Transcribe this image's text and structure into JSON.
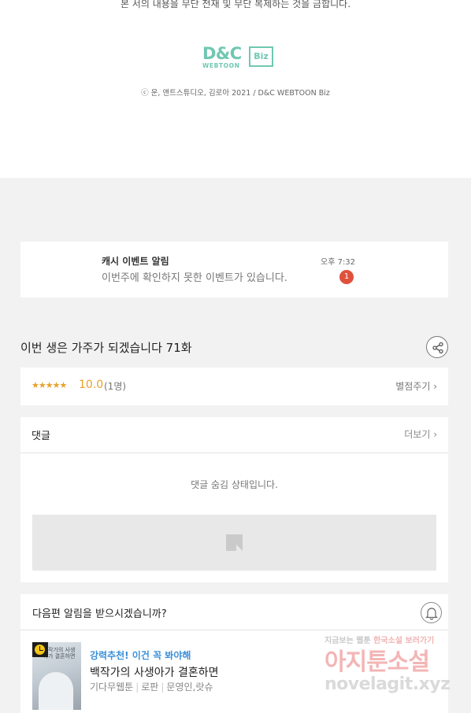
{
  "footer": {
    "notice": "본 서의 내용을 무단 전재 및 무단 복제하는 것을 금합니다.",
    "logo": {
      "main": "D&C",
      "tag": "Biz",
      "sub": "WEBTOON"
    },
    "copyright": "ⓒ 운, 앤트스튜디오, 김로아 2021 / D&C WEBTOON Biz"
  },
  "push_notice": {
    "title": "캐시 이벤트 알림",
    "message": "이번주에 확인하지 못한 이벤트가 있습니다.",
    "time": "오후 7:32",
    "badge": "1"
  },
  "episode": {
    "title": "이번 생은 가주가 되겠습니다 71화",
    "share_icon": "share-icon"
  },
  "rating": {
    "stars": "★★★★★",
    "score": "10.0",
    "count": "(1명)",
    "action": "별점주기 ›"
  },
  "comments": {
    "header": "댓글",
    "more": "더보기 ›",
    "hidden_message": "댓글 숨김 상태입니다."
  },
  "next_episode": {
    "question": "다음편 알림을 받으시겠습니까?",
    "bell_icon": "bell-icon"
  },
  "recommendation": {
    "badge": "강력추천! 이건 꼭 봐야해",
    "title": "백작가의 사생아가 결혼하면",
    "publisher": "기다무웹툰",
    "genre": "로판",
    "authors": "문영인,랏슈",
    "thumb_text": "백작가의 사생아가 결혼하면"
  },
  "watermark": {
    "line1_a": "지금보는 웹툰",
    "line1_b": "한국소설 보러가기",
    "line2": "아지툰소설",
    "line3": "novelagit.xyz"
  },
  "colors": {
    "accent_orange": "#e8a12b",
    "accent_blue": "#3b8fd9",
    "badge_red": "#e0513b",
    "brand_teal": "#6fc7b2"
  }
}
